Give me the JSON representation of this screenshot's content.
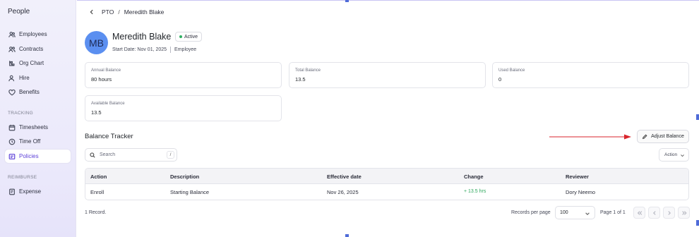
{
  "sidebar": {
    "title": "People",
    "items": [
      {
        "label": "Employees",
        "icon": "users-icon"
      },
      {
        "label": "Contracts",
        "icon": "contracts-icon"
      },
      {
        "label": "Org Chart",
        "icon": "org-chart-icon"
      },
      {
        "label": "Hire",
        "icon": "user-plus-icon"
      },
      {
        "label": "Benefits",
        "icon": "heart-icon"
      }
    ],
    "tracking_label": "TRACKING",
    "tracking_items": [
      {
        "label": "Timesheets",
        "icon": "calendar-icon"
      },
      {
        "label": "Time Off",
        "icon": "clock-icon"
      },
      {
        "label": "Policies",
        "icon": "policy-icon",
        "active": true
      }
    ],
    "reimburse_label": "REIMBURSE",
    "reimburse_items": [
      {
        "label": "Expense",
        "icon": "receipt-icon"
      }
    ]
  },
  "breadcrumb": {
    "parent": "PTO",
    "separator": "/",
    "current": "Meredith Blake"
  },
  "employee": {
    "initials": "MB",
    "name": "Meredith Blake",
    "status": "Active",
    "start_date": "Start Date: Nov 01, 2025",
    "role": "Employee"
  },
  "cards": [
    {
      "label": "Annual Balance",
      "value": "80 hours"
    },
    {
      "label": "Total Balance",
      "value": "13.5"
    },
    {
      "label": "Used Balance",
      "value": "0"
    },
    {
      "label": "Available Balance",
      "value": "13.5"
    }
  ],
  "tracker": {
    "title": "Balance Tracker",
    "adjust_label": "Adjust Balance",
    "search_placeholder": "Search",
    "search_shortcut": "/",
    "action_label": "Action"
  },
  "table": {
    "columns": [
      "Action",
      "Description",
      "Effective date",
      "Change",
      "Reviewer"
    ],
    "rows": [
      [
        "Enroll",
        "Starting Balance",
        "Nov 26, 2025",
        "+ 13.5 hrs",
        "Dory Neemo"
      ]
    ]
  },
  "footer": {
    "records": "1 Record.",
    "records_per_page_label": "Records per page",
    "records_per_page": "100",
    "page_info": "Page 1 of 1"
  },
  "colors": {
    "accent": "#5b3fd8",
    "positive": "#2fa85e",
    "avatar": "#5b8ff0",
    "annotation_arrow": "#d8262c"
  }
}
